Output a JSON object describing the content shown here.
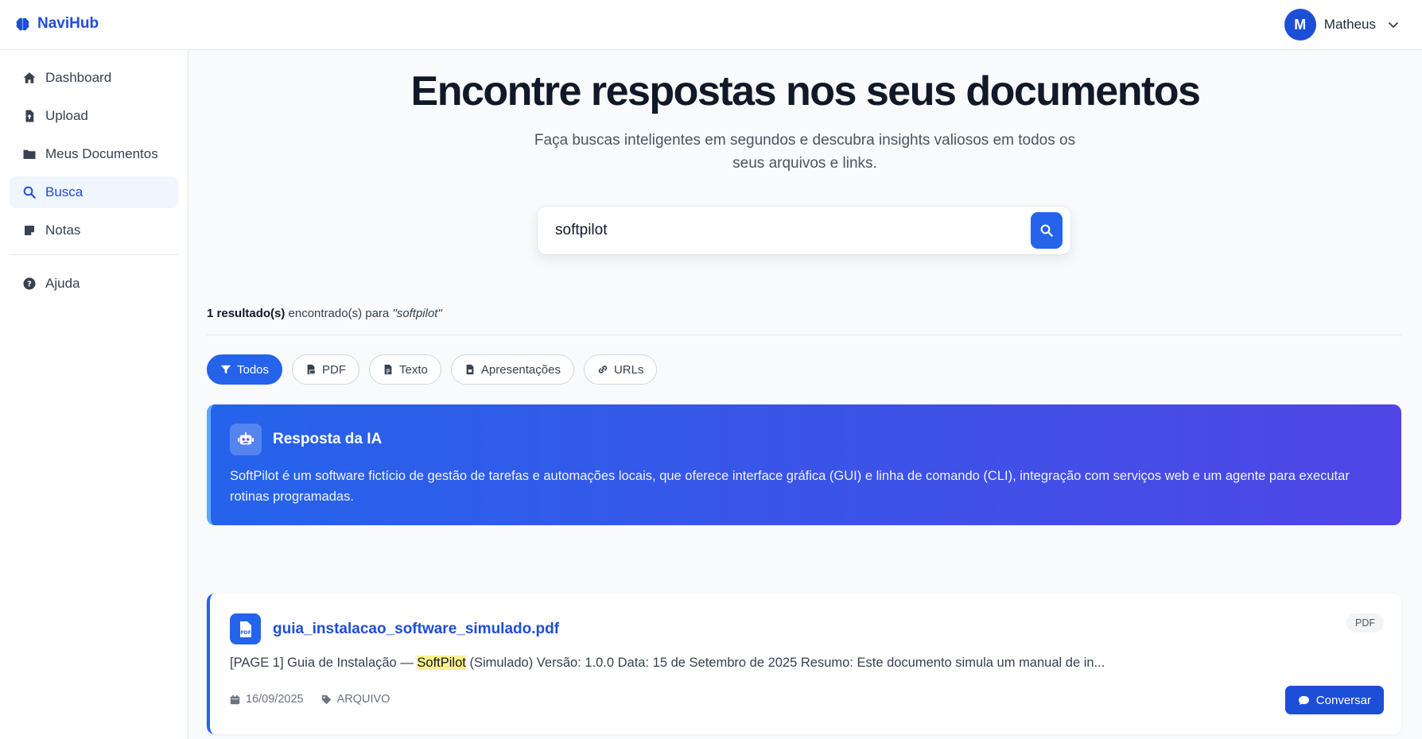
{
  "app": {
    "name": "NaviHub",
    "icon": "brain-icon"
  },
  "user": {
    "initial": "M",
    "name": "Matheus"
  },
  "sidebar": {
    "items": [
      {
        "label": "Dashboard",
        "icon": "home-icon"
      },
      {
        "label": "Upload",
        "icon": "file-upload-icon"
      },
      {
        "label": "Meus Documentos",
        "icon": "folder-icon"
      },
      {
        "label": "Busca",
        "icon": "search-icon",
        "active": true
      },
      {
        "label": "Notas",
        "icon": "note-icon"
      },
      {
        "label": "Ajuda",
        "icon": "help-icon"
      }
    ]
  },
  "hero": {
    "title": "Encontre respostas nos seus documentos",
    "subtitle": "Faça buscas inteligentes em segundos e descubra insights valiosos em todos os seus arquivos e links."
  },
  "search": {
    "value": "softpilot"
  },
  "results": {
    "count_bold": "1 resultado(s)",
    "count_rest": " encontrado(s) para ",
    "query": "\"softpilot\""
  },
  "filters": [
    {
      "label": "Todos",
      "icon": "filter-icon",
      "active": true
    },
    {
      "label": "PDF",
      "icon": "pdf-icon"
    },
    {
      "label": "Texto",
      "icon": "text-file-icon"
    },
    {
      "label": "Apresentações",
      "icon": "presentation-icon"
    },
    {
      "label": "URLs",
      "icon": "link-icon"
    }
  ],
  "ai_answer": {
    "title": "Resposta da IA",
    "icon": "robot-icon",
    "text": "SoftPilot é um software fictício de gestão de tarefas e automações locais, que oferece interface gráfica (GUI) e linha de comando (CLI), integração com serviços web e um agente para executar rotinas programadas."
  },
  "document": {
    "title": "guia_instalacao_software_simulado.pdf",
    "badge": "PDF",
    "snippet_before": "[PAGE 1] Guia de Instalação — ",
    "snippet_highlight": "SoftPilot",
    "snippet_after": " (Simulado) Versão: 1.0.0 Data: 15 de Setembro de 2025 Resumo: Este documento simula um manual de in...",
    "date": "16/09/2025",
    "tag": "ARQUIVO",
    "chat_label": "Conversar"
  },
  "colors": {
    "primary": "#2563eb",
    "primary_dark": "#1d4ed8",
    "highlight": "#fef08a",
    "ai_gradient_end": "#4f46e5"
  }
}
